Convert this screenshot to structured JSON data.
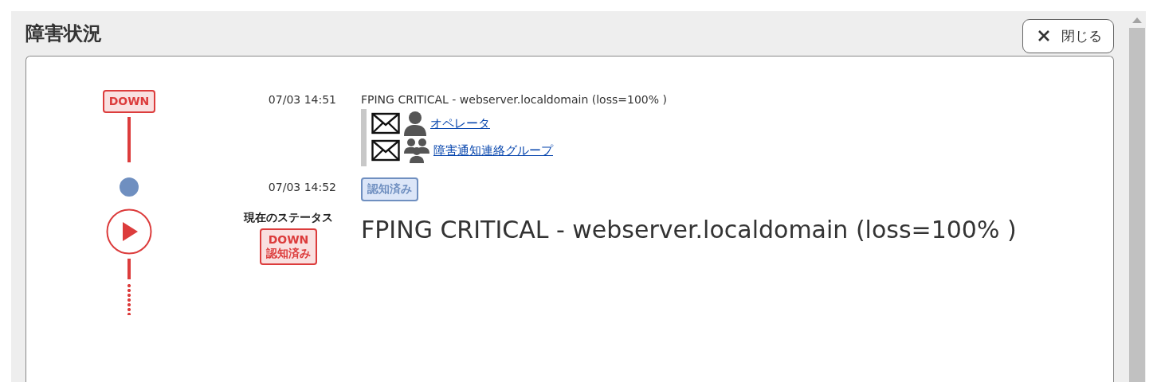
{
  "header": {
    "title": "障害状況",
    "close_button": "閉じる"
  },
  "events": [
    {
      "kind": "state",
      "badge": "DOWN",
      "time": "07/03 14:51",
      "message": "FPING CRITICAL - webserver.localdomain (loss=100% )",
      "notifications": [
        {
          "kind": "user",
          "recipient": "オペレータ"
        },
        {
          "kind": "group",
          "recipient": "障害通知連絡グループ"
        }
      ]
    },
    {
      "kind": "ack",
      "time": "07/03 14:52",
      "badge": "認知済み"
    }
  ],
  "current": {
    "label": "現在のステータス",
    "status": [
      "DOWN",
      "認知済み"
    ],
    "message": "FPING CRITICAL - webserver.localdomain (loss=100% )"
  }
}
